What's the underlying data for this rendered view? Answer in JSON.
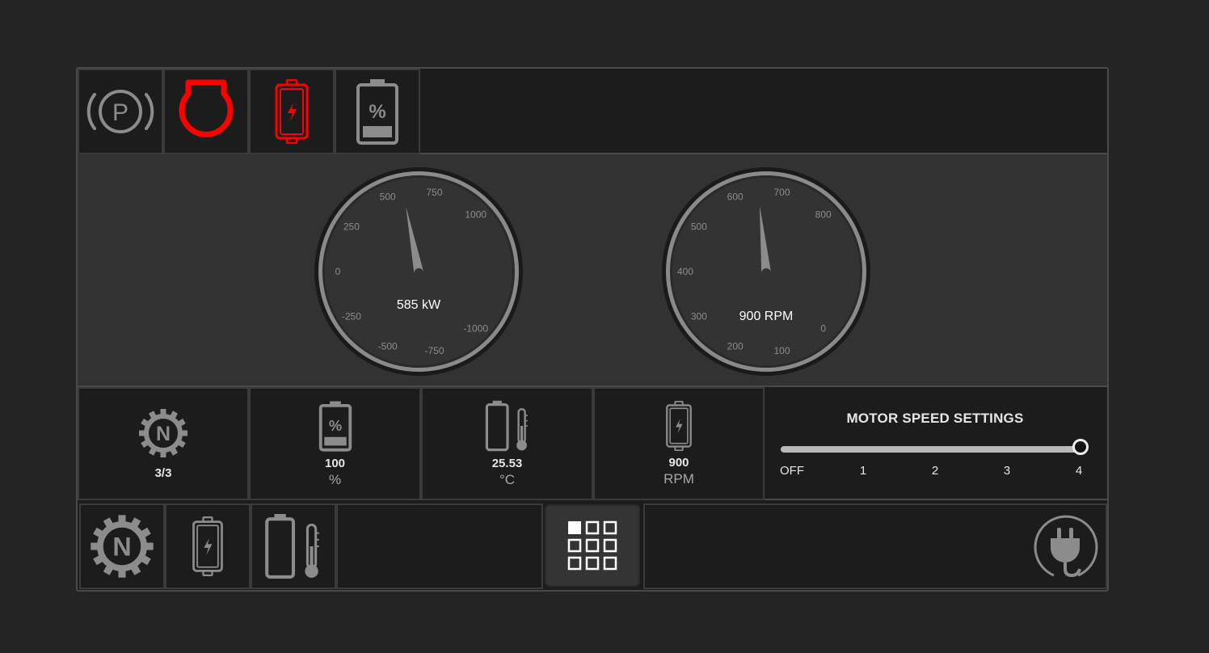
{
  "warning_icons": [
    {
      "name": "parking-brake-icon",
      "color": "#8c8c8c"
    },
    {
      "name": "engine-icon",
      "color": "#ff0000"
    },
    {
      "name": "battery-charge-icon",
      "color": "#ff0000"
    },
    {
      "name": "battery-percent-icon",
      "color": "#8c8c8c"
    }
  ],
  "power_gauge": {
    "ticks": [
      "-1000",
      "-750",
      "-500",
      "-250",
      "0",
      "250",
      "500",
      "750",
      "1000"
    ],
    "readout": "585 kW",
    "value": 585,
    "min": -1000,
    "max": 1000
  },
  "rpm_gauge": {
    "ticks": [
      "0",
      "100",
      "200",
      "300",
      "400",
      "500",
      "600",
      "700",
      "800"
    ],
    "readout": "900 RPM",
    "value": 900,
    "min": 0,
    "max": 800
  },
  "stats": {
    "gear": {
      "value": "3/3",
      "icon": "neutral-gear-icon"
    },
    "battery": {
      "value": "100",
      "unit": "%",
      "icon": "battery-percent-icon"
    },
    "temperature": {
      "value": "25.53",
      "unit": "°C",
      "icon": "battery-temperature-icon"
    },
    "rpm": {
      "value": "900",
      "unit": "RPM",
      "icon": "battery-charge-icon"
    }
  },
  "motor_speed": {
    "title": "MOTOR SPEED SETTINGS",
    "ticks": [
      "OFF",
      "1",
      "2",
      "3",
      "4"
    ],
    "selected": "4"
  },
  "bottom_bar": {
    "icons": [
      "neutral-gear-icon",
      "battery-charge-icon",
      "battery-temperature-icon"
    ],
    "menu_icon": "grid-menu-icon",
    "plug_icon": "plug-icon"
  },
  "colors": {
    "background": "#242424",
    "panel": "#1c1c1c",
    "gauge_bg": "#323232",
    "alert": "#ff0000",
    "icon_gray": "#8c8c8c"
  }
}
